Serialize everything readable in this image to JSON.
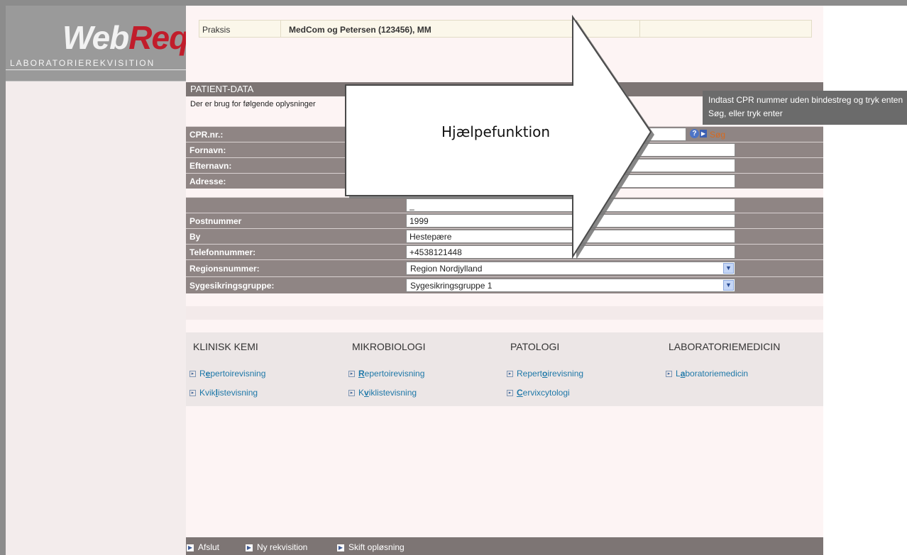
{
  "logo": {
    "web": "Web",
    "req": "Req",
    "subtitle": "LABORATORIEREKVISITION"
  },
  "praksis": {
    "label": "Praksis",
    "value": "MedCom og Petersen (123456), MM"
  },
  "patient": {
    "title": "PATIENT-DATA",
    "subtitle": "Der er brug for følgende oplysninger",
    "fields": [
      {
        "label": "CPR.nr.:",
        "value": ""
      },
      {
        "label": "Fornavn:",
        "value": ""
      },
      {
        "label": "Efternavn:",
        "value": ""
      },
      {
        "label": "Adresse:",
        "value": ""
      },
      {
        "label": "",
        "value": "_"
      },
      {
        "label": "Postnummer",
        "value": "1999"
      },
      {
        "label": "By",
        "value": "Hestepære"
      },
      {
        "label": "Telefonnummer:",
        "value": "+4538121448"
      },
      {
        "label": "Regionsnummer:",
        "value": "Region Nordjylland"
      },
      {
        "label": "Sygesikringsgruppe:",
        "value": "Sygesikringsgruppe 1"
      }
    ],
    "search_label": "Søg"
  },
  "help": {
    "label": "Hjælpefunktion",
    "tooltip": "Indtast CPR nummer uden bindestreg og tryk enten Søg, eller tryk enter"
  },
  "lab": {
    "columns": [
      {
        "title": "KLINISK KEMI",
        "links": [
          {
            "pre": "R",
            "key": "e",
            "post": "pertoirevisning"
          },
          {
            "pre": "Kvik",
            "key": "l",
            "post": "istevisning"
          }
        ]
      },
      {
        "title": "MIKROBIOLOGI",
        "links": [
          {
            "pre": "",
            "key": "R",
            "post": "epertoirevisning"
          },
          {
            "pre": "K",
            "key": "v",
            "post": "iklistevisning"
          }
        ]
      },
      {
        "title": "PATOLOGI",
        "links": [
          {
            "pre": "Repert",
            "key": "o",
            "post": "irevisning"
          },
          {
            "pre": "",
            "key": "C",
            "post": "ervixcytologi"
          }
        ]
      },
      {
        "title": "LABORATORIEMEDICIN",
        "links": [
          {
            "pre": "L",
            "key": "a",
            "post": "boratoriemedicin"
          }
        ]
      }
    ]
  },
  "footer": {
    "items": [
      "Afslut",
      "Ny rekvisition",
      "Skift opløsning"
    ]
  },
  "colors": {
    "header": "#7d7574",
    "row": "#8f8584",
    "link": "#1e78a8",
    "search": "#d7691e",
    "logo_red": "#c11d2b"
  }
}
